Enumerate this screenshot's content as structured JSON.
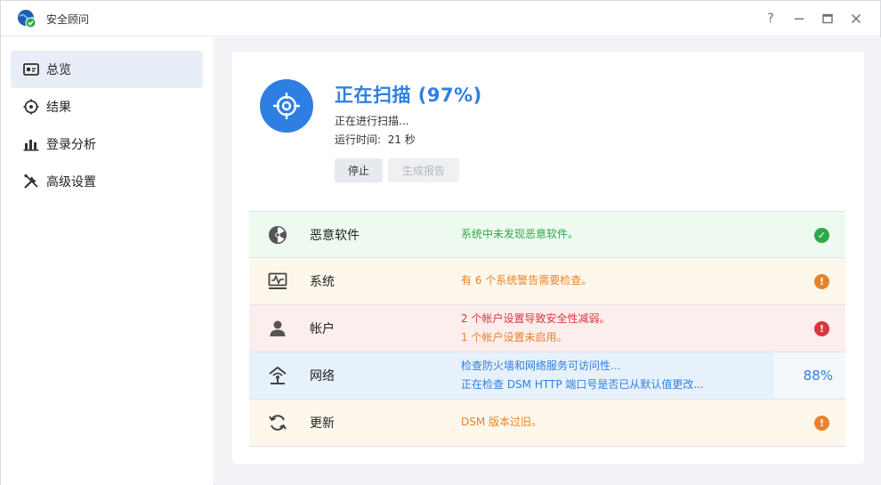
{
  "window": {
    "title": "安全顾问",
    "help_symbol": "?"
  },
  "sidebar": {
    "items": [
      {
        "label": "总览",
        "icon": "overview-icon",
        "active": true
      },
      {
        "label": "结果",
        "icon": "results-icon",
        "active": false
      },
      {
        "label": "登录分析",
        "icon": "bar-chart-icon",
        "active": false
      },
      {
        "label": "高级设置",
        "icon": "tools-icon",
        "active": false
      }
    ]
  },
  "scan": {
    "title": "正在扫描 (97%)",
    "status": "正在进行扫描...",
    "runtime_label": "运行时间:",
    "runtime_value": "21 秒",
    "stop_label": "停止",
    "report_label": "生成报告"
  },
  "categories": [
    {
      "label": "恶意软件",
      "messages": [
        "系统中未发现恶意软件。"
      ],
      "status": "ok",
      "status_symbol": "✓",
      "icon": "radiation-icon"
    },
    {
      "label": "系统",
      "messages": [
        "有 6 个系统警告需要检查。"
      ],
      "status": "warning",
      "status_symbol": "!",
      "icon": "system-monitor-icon"
    },
    {
      "label": "帐户",
      "messages": [
        "2 个帐户设置导致安全性减弱。",
        "1 个帐户设置未启用。"
      ],
      "status": "danger",
      "status_symbol": "!",
      "icon": "user-icon"
    },
    {
      "label": "网络",
      "messages": [
        "检查防火墙和网络服务可访问性...",
        "正在检查 DSM HTTP 端口号是否已从默认值更改..."
      ],
      "status": "scanning",
      "progress_text": "88%",
      "progress": 0.88,
      "icon": "network-icon"
    },
    {
      "label": "更新",
      "messages": [
        "DSM 版本过旧。"
      ],
      "status": "warning",
      "status_symbol": "!",
      "icon": "update-icon"
    }
  ],
  "colors": {
    "accent": "#2f7fe3",
    "ok": "#2ea84a",
    "warning": "#e8832b",
    "danger": "#d9363e",
    "ok_bg": "#eefaf0",
    "warning_bg": "#fef8ec",
    "danger_bg": "#fdeeee",
    "scanning_bg": "#f5f8fb"
  }
}
